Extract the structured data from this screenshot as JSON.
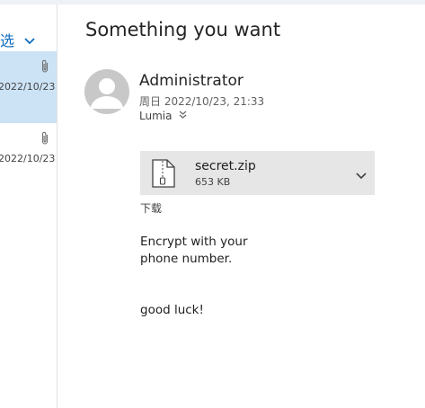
{
  "list": {
    "filter_label": "选",
    "items": [
      {
        "date": "2022/10/23",
        "selected": true
      },
      {
        "date": "2022/10/23",
        "selected": false
      }
    ]
  },
  "message": {
    "subject": "Something you want",
    "sender": "Administrator",
    "sent": "周日 2022/10/23, 21:33",
    "recipient": "Lumia",
    "attachment": {
      "name": "secret.zip",
      "size": "653 KB",
      "download_label": "下载"
    },
    "body": {
      "line1": "Encrypt with your",
      "line2": "phone number.",
      "line3": "good luck!"
    }
  },
  "colors": {
    "accent": "#0f6cbd",
    "selected_bg": "#cce3f6",
    "attachment_bg": "#e6e6e6"
  }
}
